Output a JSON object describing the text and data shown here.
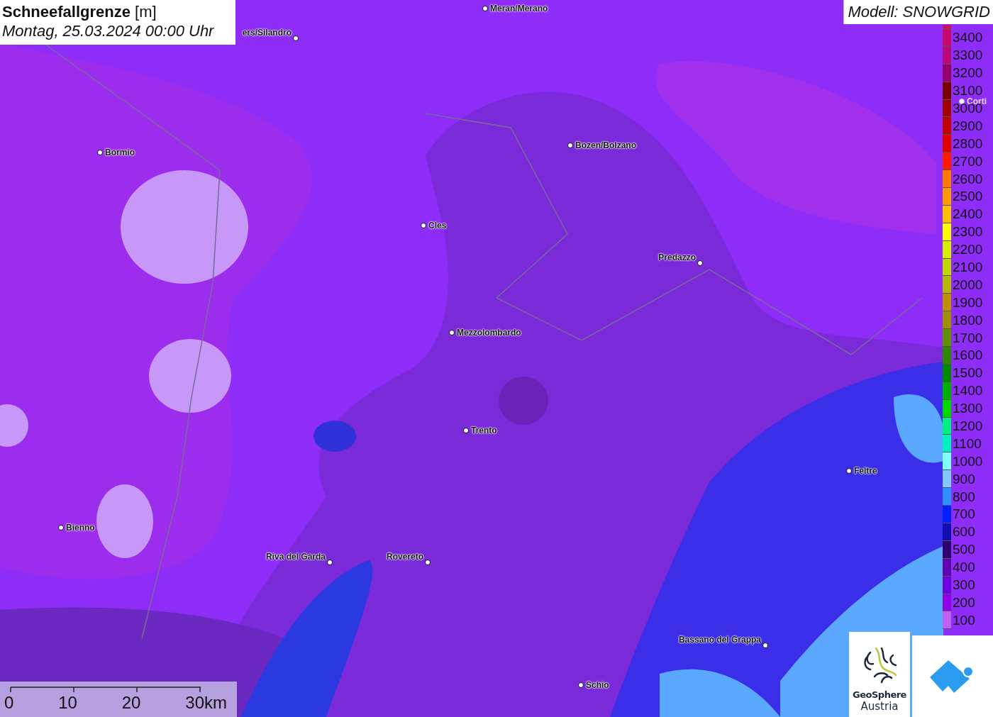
{
  "title": {
    "variable": "Schneefallgrenze",
    "unit": "[m]",
    "datetime": "Montag, 25.03.2024 00:00 Uhr"
  },
  "model_label": "Modell: SNOWGRID",
  "cities": [
    {
      "name": "Meran/Merano"
    },
    {
      "name": "ers/Silandro"
    },
    {
      "name": "Bormio"
    },
    {
      "name": "Bozen/Bolzano"
    },
    {
      "name": "Cles"
    },
    {
      "name": "Predazzo"
    },
    {
      "name": "Mezzolombardo"
    },
    {
      "name": "Trento"
    },
    {
      "name": "Feltre"
    },
    {
      "name": "Bienno"
    },
    {
      "name": "Riva del Garda"
    },
    {
      "name": "Rovereto"
    },
    {
      "name": "Bassano del Grappa"
    },
    {
      "name": "Schio"
    },
    {
      "name": "Corti"
    }
  ],
  "legend": [
    {
      "label": "3400",
      "color": "#c8086c"
    },
    {
      "label": "3300",
      "color": "#b8087a"
    },
    {
      "label": "3200",
      "color": "#98006e"
    },
    {
      "label": "3100",
      "color": "#780000"
    },
    {
      "label": "3000",
      "color": "#a00000"
    },
    {
      "label": "2900",
      "color": "#c00000"
    },
    {
      "label": "2800",
      "color": "#e00000"
    },
    {
      "label": "2700",
      "color": "#ff1a00"
    },
    {
      "label": "2600",
      "color": "#ff7a00"
    },
    {
      "label": "2500",
      "color": "#ff9a00"
    },
    {
      "label": "2400",
      "color": "#ffbe00"
    },
    {
      "label": "2300",
      "color": "#ffff00"
    },
    {
      "label": "2200",
      "color": "#d8f000"
    },
    {
      "label": "2100",
      "color": "#c0d800"
    },
    {
      "label": "2000",
      "color": "#b8b800"
    },
    {
      "label": "1900",
      "color": "#c09000"
    },
    {
      "label": "1800",
      "color": "#a09000"
    },
    {
      "label": "1700",
      "color": "#609000"
    },
    {
      "label": "1600",
      "color": "#308800"
    },
    {
      "label": "1500",
      "color": "#008800"
    },
    {
      "label": "1400",
      "color": "#00b000"
    },
    {
      "label": "1300",
      "color": "#00d800"
    },
    {
      "label": "1200",
      "color": "#00f080"
    },
    {
      "label": "1100",
      "color": "#00f0c0"
    },
    {
      "label": "1000",
      "color": "#80ffff"
    },
    {
      "label": "900",
      "color": "#80c8ff"
    },
    {
      "label": "800",
      "color": "#3090ff"
    },
    {
      "label": "700",
      "color": "#0020ff"
    },
    {
      "label": "600",
      "color": "#1010b0"
    },
    {
      "label": "500",
      "color": "#300070"
    },
    {
      "label": "400",
      "color": "#6000b0"
    },
    {
      "label": "300",
      "color": "#7000e0"
    },
    {
      "label": "200",
      "color": "#9000e8"
    },
    {
      "label": "100",
      "color": "#c060f0"
    }
  ],
  "scale_bar": {
    "ticks": [
      "0",
      "10",
      "20",
      "30km"
    ]
  },
  "logo": {
    "line1": "GeoSphere",
    "line2": "Austria"
  }
}
